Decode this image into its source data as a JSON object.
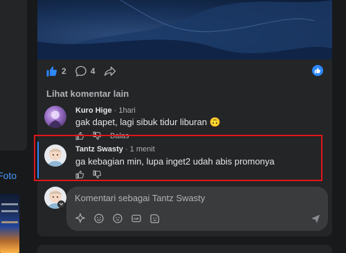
{
  "left": {
    "foto_label": "Foto"
  },
  "post": {
    "like_count": "2",
    "comment_count": "4"
  },
  "comments_section": {
    "more_label": "Lihat komentar lain",
    "comments": [
      {
        "author": "Kuro Hige",
        "time": "1hari",
        "text": "gak dapet, lagi sibuk tidur liburan",
        "emoji": "🙃",
        "reply_label": "Balas"
      },
      {
        "author": "Tantz Swasty",
        "time": "1 menit",
        "text": "ga kebagian min, lupa inget2 udah abis promonya"
      }
    ]
  },
  "composer": {
    "placeholder": "Komentari sebagai Tantz Swasty"
  },
  "colors": {
    "accent": "#2d88ff",
    "highlight": "#e0161b",
    "card": "#242526",
    "input": "#3a3b3c"
  }
}
